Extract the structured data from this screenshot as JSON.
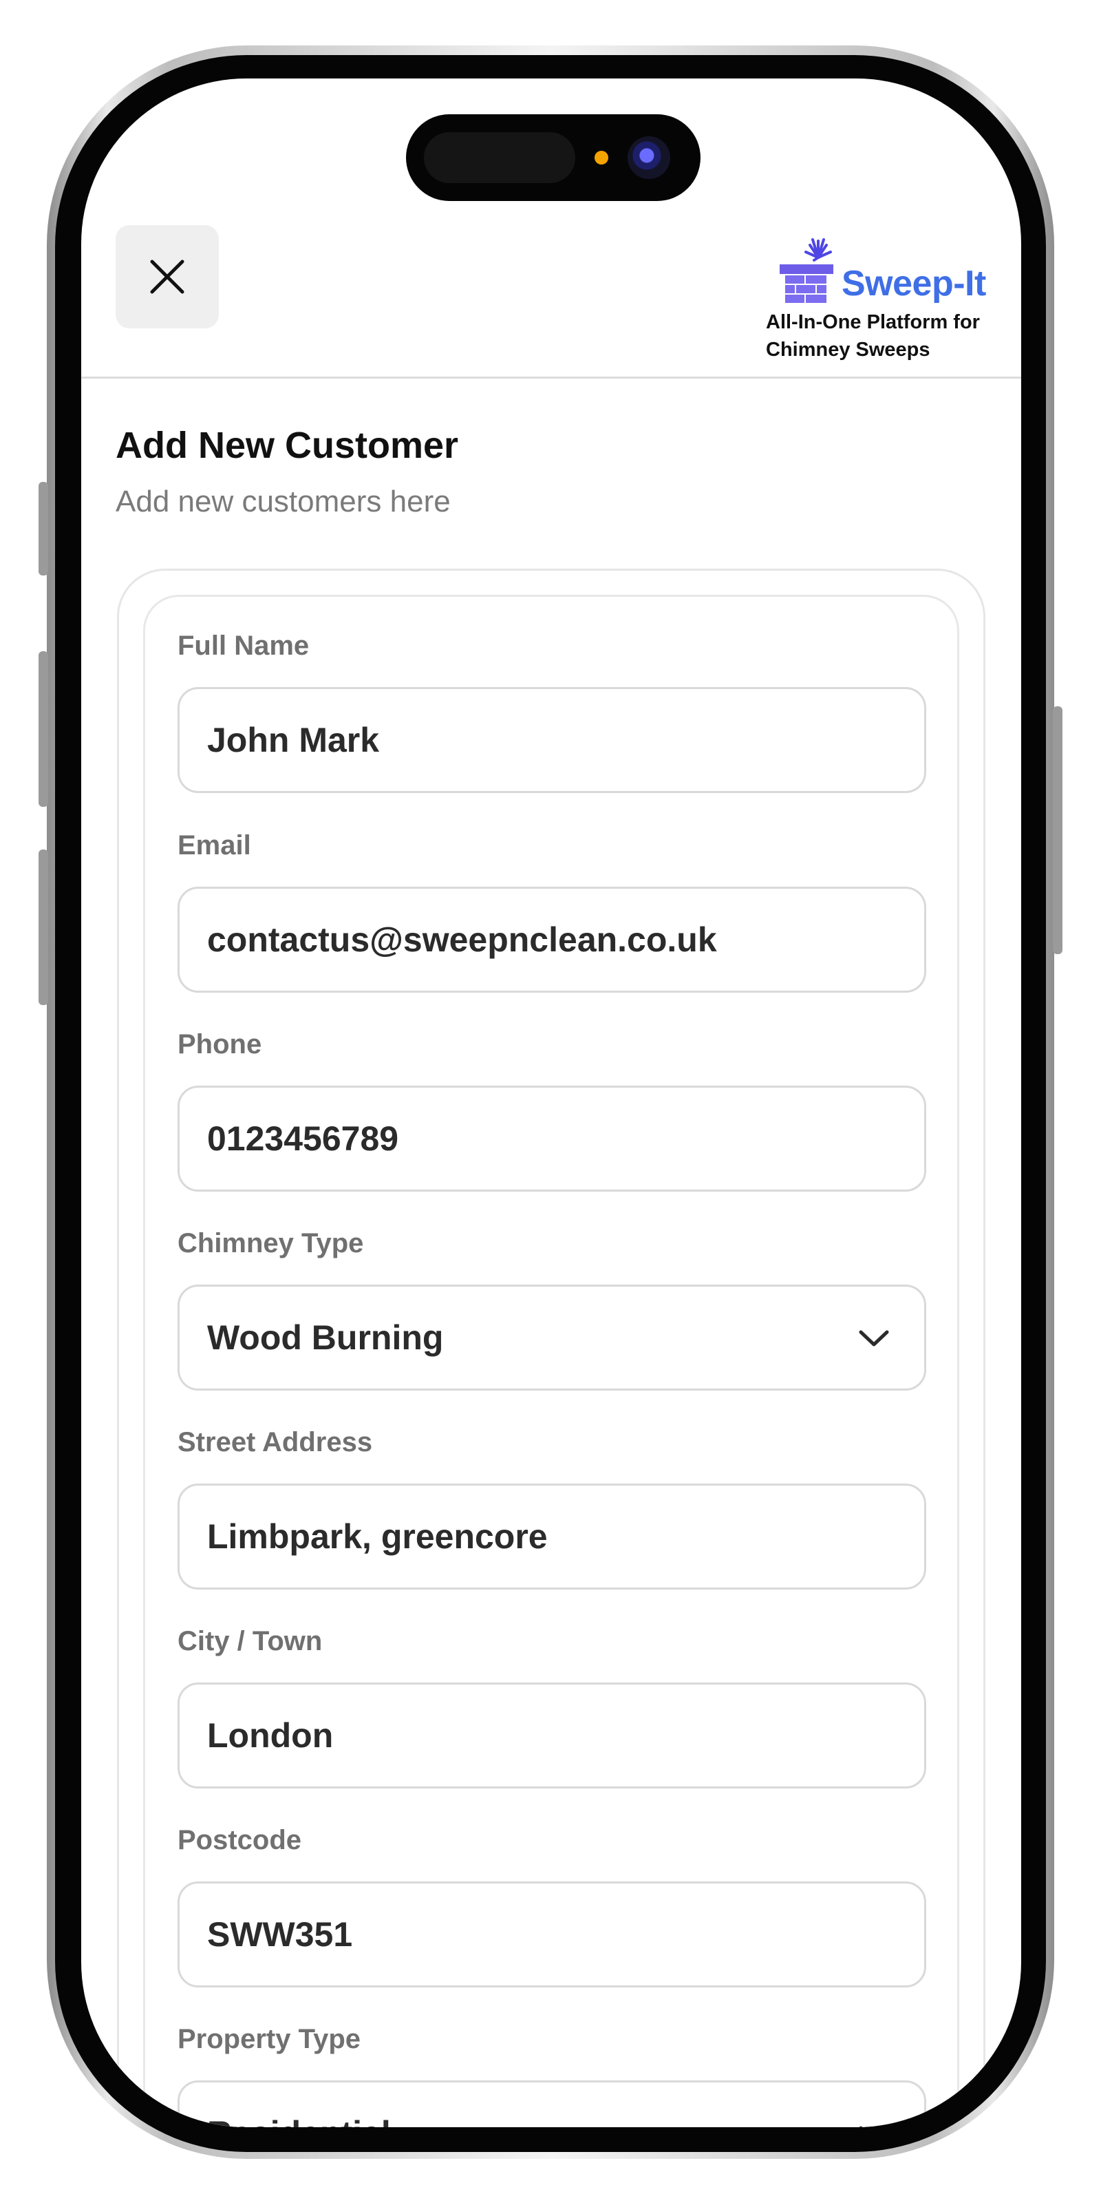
{
  "header": {
    "close_icon": "close-icon",
    "brand": {
      "name": "Sweep-It",
      "tagline_line1": "All-In-One Platform for",
      "tagline_line2": "Chimney Sweeps",
      "color": "#3f6fe6",
      "logo_icon": "chimney-brush-icon"
    }
  },
  "page": {
    "title": "Add New Customer",
    "subtitle": "Add new customers here"
  },
  "form": {
    "full_name": {
      "label": "Full Name",
      "value": "John Mark"
    },
    "email": {
      "label": "Email",
      "value": "contactus@sweepnclean.co.uk"
    },
    "phone": {
      "label": "Phone",
      "value": "0123456789"
    },
    "chimney_type": {
      "label": "Chimney Type",
      "value": "Wood Burning",
      "icon": "chevron-down-icon"
    },
    "street_address": {
      "label": "Street Address",
      "value": "Limbpark, greencore"
    },
    "city": {
      "label": "City / Town",
      "value": "London"
    },
    "postcode": {
      "label": "Postcode",
      "value": "SWW351"
    },
    "property_type": {
      "label": "Property Type",
      "value": "Residential",
      "icon": "chevron-down-icon"
    }
  }
}
